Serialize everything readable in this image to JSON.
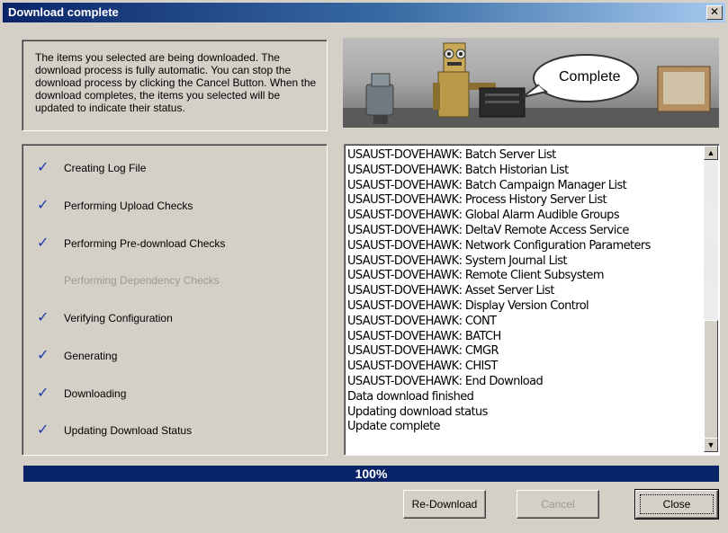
{
  "window": {
    "title": "Download complete",
    "close_glyph": "✕"
  },
  "intro": {
    "text": "The items you selected are being downloaded.  The download process is fully automatic.  You can stop the download process by clicking the Cancel Button.  When the download completes, the items you selected will be updated to indicate their status."
  },
  "banner": {
    "bubble_text": "Complete"
  },
  "steps": [
    {
      "label": "Creating Log File",
      "checked": true
    },
    {
      "label": "Performing Upload Checks",
      "checked": true
    },
    {
      "label": "Performing Pre-download Checks",
      "checked": true
    },
    {
      "label": "Performing Dependency Checks",
      "checked": false
    },
    {
      "label": "Verifying Configuration",
      "checked": true
    },
    {
      "label": "Generating",
      "checked": true
    },
    {
      "label": "Downloading",
      "checked": true
    },
    {
      "label": "Updating Download Status",
      "checked": true
    }
  ],
  "log": [
    "USAUST-DOVEHAWK: Batch Server List",
    "USAUST-DOVEHAWK: Batch Historian List",
    "USAUST-DOVEHAWK: Batch Campaign Manager List",
    "USAUST-DOVEHAWK: Process History Server List",
    "USAUST-DOVEHAWK: Global Alarm Audible Groups",
    "USAUST-DOVEHAWK: DeltaV Remote Access Service",
    "USAUST-DOVEHAWK: Network Configuration Parameters",
    "USAUST-DOVEHAWK: System Journal List",
    "USAUST-DOVEHAWK: Remote Client Subsystem",
    "USAUST-DOVEHAWK: Asset Server List",
    "USAUST-DOVEHAWK: Display Version Control",
    "USAUST-DOVEHAWK: CONT",
    "USAUST-DOVEHAWK: BATCH",
    "USAUST-DOVEHAWK: CMGR",
    "USAUST-DOVEHAWK: CHIST",
    "USAUST-DOVEHAWK: End Download",
    "Data download finished",
    "Updating download status",
    "Update complete"
  ],
  "progress": {
    "value": 100,
    "label": "100%"
  },
  "buttons": {
    "redownload": "Re-Download",
    "cancel": "Cancel",
    "close": "Close"
  },
  "colors": {
    "title_bar": "#0a246a",
    "progress_fill": "#0a246a",
    "check_mark": "#1c3aa9",
    "dialog_bg": "#d4d0c8"
  }
}
